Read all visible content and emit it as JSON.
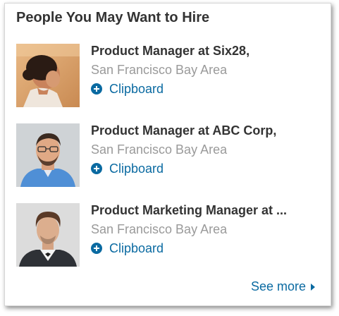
{
  "widget": {
    "title": "People You May Want to Hire",
    "see_more_label": "See more"
  },
  "people": [
    {
      "role": "Product Manager at Six28,",
      "location": "San Francisco Bay Area",
      "action_label": "Clipboard"
    },
    {
      "role": "Product Manager at ABC Corp,",
      "location": "San Francisco Bay Area",
      "action_label": "Clipboard"
    },
    {
      "role": "Product Marketing Manager at ...",
      "location": "San Francisco Bay Area",
      "action_label": "Clipboard"
    }
  ],
  "colors": {
    "accent": "#0a6aa1",
    "heading": "#333333",
    "muted": "#9a9a9a"
  },
  "icons": {
    "add": "plus-circle-icon",
    "more": "chevron-right-icon"
  }
}
